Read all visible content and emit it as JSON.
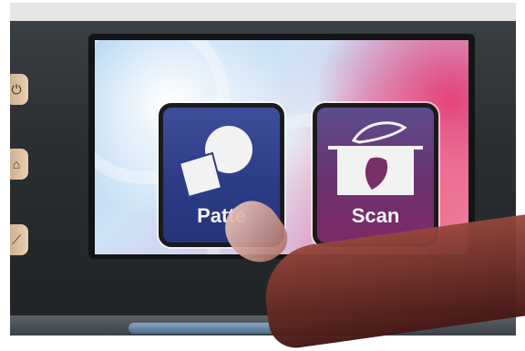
{
  "screen": {
    "tiles": [
      {
        "label": "Patte",
        "icon": "shapes-icon"
      },
      {
        "label": "Scan",
        "icon": "leaf-scan-icon"
      }
    ]
  },
  "colors": {
    "pattern_tile": "#2c3c86",
    "scan_tile": "#6a3270",
    "device": "#2a2e31",
    "side_buttons": "#e0c3a3"
  }
}
